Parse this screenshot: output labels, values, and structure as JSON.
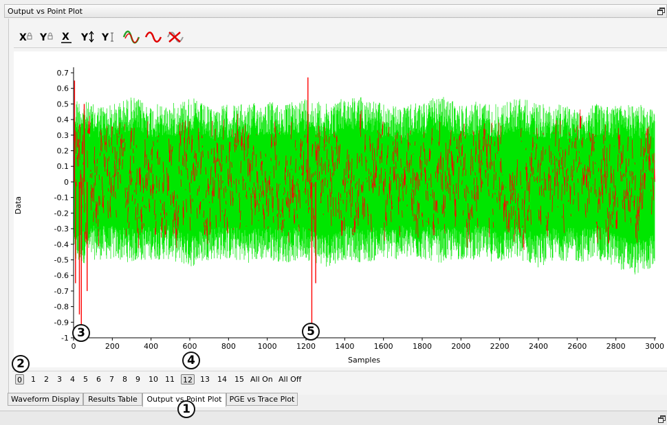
{
  "window": {
    "title": "Output vs Point Plot"
  },
  "toolbar": {
    "buttons": [
      {
        "icon": "x-lock-icon",
        "label": "X"
      },
      {
        "icon": "y-lock-icon",
        "label": "Y"
      },
      {
        "icon": "x-fit-icon",
        "label": "X"
      },
      {
        "icon": "y-autoscale-icon",
        "label": "Y"
      },
      {
        "icon": "y-cursor-icon",
        "label": "Y"
      },
      {
        "icon": "waveform-green-red-icon",
        "label": ""
      },
      {
        "icon": "waveform-red-icon",
        "label": ""
      },
      {
        "icon": "waveform-remove-icon",
        "label": ""
      }
    ]
  },
  "chart_data": {
    "type": "line",
    "title": "",
    "xlabel": "Samples",
    "ylabel": "Data",
    "xlim": [
      0,
      3000
    ],
    "ylim": [
      -1,
      0.7
    ],
    "x_ticks": [
      0,
      200,
      400,
      600,
      800,
      1000,
      1200,
      1400,
      1600,
      1800,
      2000,
      2200,
      2400,
      2600,
      2800,
      3000
    ],
    "y_ticks": [
      0.7,
      0.6,
      0.5,
      0.4,
      0.3,
      0.2,
      0.1,
      0,
      -0.1,
      -0.2,
      -0.3,
      -0.4,
      -0.5,
      -0.6,
      -0.7,
      -0.8,
      -0.9,
      -1
    ],
    "y_tick_labels": [
      "0.7",
      "0.6",
      "0.5",
      "0.4",
      "0.3",
      "0.2",
      "0.1",
      "0",
      "-0.1",
      "-0.2",
      "-0.3",
      "-0.4",
      "-0.5",
      "-0.6",
      "-0.7",
      "-0.8",
      "-0.9",
      "-1"
    ],
    "grid": false,
    "series": [
      {
        "color": "#00e600",
        "description_band": {
          "upper": [
            0.5,
            0.35
          ],
          "lower": [
            -0.5,
            -0.3
          ]
        },
        "x": [
          0,
          100,
          200,
          300,
          400,
          500,
          600,
          700,
          800,
          900,
          1000,
          1100,
          1200,
          1300,
          1400,
          1500,
          1600,
          1700,
          1800,
          1900,
          2000,
          2100,
          2200,
          2300,
          2400,
          2500,
          2600,
          2700,
          2800,
          2900,
          3000
        ],
        "y_max": [
          0.55,
          0.5,
          0.5,
          0.55,
          0.5,
          0.5,
          0.55,
          0.48,
          0.5,
          0.5,
          0.52,
          0.5,
          0.55,
          0.5,
          0.55,
          0.55,
          0.5,
          0.48,
          0.52,
          0.55,
          0.5,
          0.52,
          0.5,
          0.55,
          0.5,
          0.5,
          0.48,
          0.5,
          0.5,
          0.5,
          0.48
        ],
        "y_min": [
          -0.55,
          -0.5,
          -0.5,
          -0.52,
          -0.5,
          -0.5,
          -0.55,
          -0.5,
          -0.5,
          -0.52,
          -0.5,
          -0.52,
          -0.5,
          -0.55,
          -0.5,
          -0.52,
          -0.5,
          -0.5,
          -0.5,
          -0.52,
          -0.5,
          -0.5,
          -0.52,
          -0.5,
          -0.55,
          -0.5,
          -0.52,
          -0.5,
          -0.55,
          -0.6,
          -0.55
        ]
      },
      {
        "color": "#ff0000",
        "x": [
          0,
          100,
          200,
          300,
          400,
          500,
          600,
          700,
          800,
          900,
          1000,
          1100,
          1200,
          1300,
          1400,
          1500,
          1600,
          1700,
          1800,
          1900,
          2000,
          2100,
          2200,
          2300,
          2400,
          2500,
          2600,
          2700,
          2800,
          2900,
          3000
        ],
        "y_max": [
          0.35,
          0.3,
          0.3,
          0.35,
          0.3,
          0.35,
          0.3,
          0.3,
          0.35,
          0.3,
          0.3,
          0.35,
          0.3,
          0.3,
          0.3,
          0.35,
          0.3,
          0.3,
          0.35,
          0.3,
          0.3,
          0.35,
          0.3,
          0.3,
          0.35,
          0.3,
          0.35,
          0.3,
          0.3,
          0.3,
          0.3
        ],
        "y_min": [
          -0.35,
          -0.3,
          -0.3,
          -0.3,
          -0.35,
          -0.3,
          -0.3,
          -0.35,
          -0.3,
          -0.3,
          -0.3,
          -0.35,
          -0.3,
          -0.3,
          -0.35,
          -0.3,
          -0.3,
          -0.3,
          -0.35,
          -0.3,
          -0.3,
          -0.35,
          -0.3,
          -0.35,
          -0.3,
          -0.3,
          -0.35,
          -0.3,
          -0.3,
          -0.3,
          -0.3
        ],
        "spikes": [
          {
            "x": 5,
            "y": 0.65
          },
          {
            "x": 10,
            "y": -0.65
          },
          {
            "x": 30,
            "y": -0.85
          },
          {
            "x": 40,
            "y": -0.95
          },
          {
            "x": 55,
            "y": 0.5
          },
          {
            "x": 70,
            "y": -0.7
          },
          {
            "x": 1210,
            "y": 0.67
          },
          {
            "x": 1230,
            "y": -0.98
          },
          {
            "x": 1250,
            "y": -0.65
          }
        ]
      }
    ]
  },
  "channels": {
    "items": [
      "0",
      "1",
      "2",
      "3",
      "4",
      "5",
      "6",
      "7",
      "8",
      "9",
      "10",
      "11",
      "12",
      "13",
      "14",
      "15",
      "All On",
      "All Off"
    ],
    "selected": [
      "0",
      "12"
    ]
  },
  "tabs": [
    {
      "label": "Waveform Display",
      "active": false
    },
    {
      "label": "Results Table",
      "active": false
    },
    {
      "label": "Output vs Point Plot",
      "active": true
    },
    {
      "label": "PGE vs Trace Plot",
      "active": false
    }
  ],
  "callouts": [
    "1",
    "2",
    "3",
    "4",
    "5"
  ]
}
